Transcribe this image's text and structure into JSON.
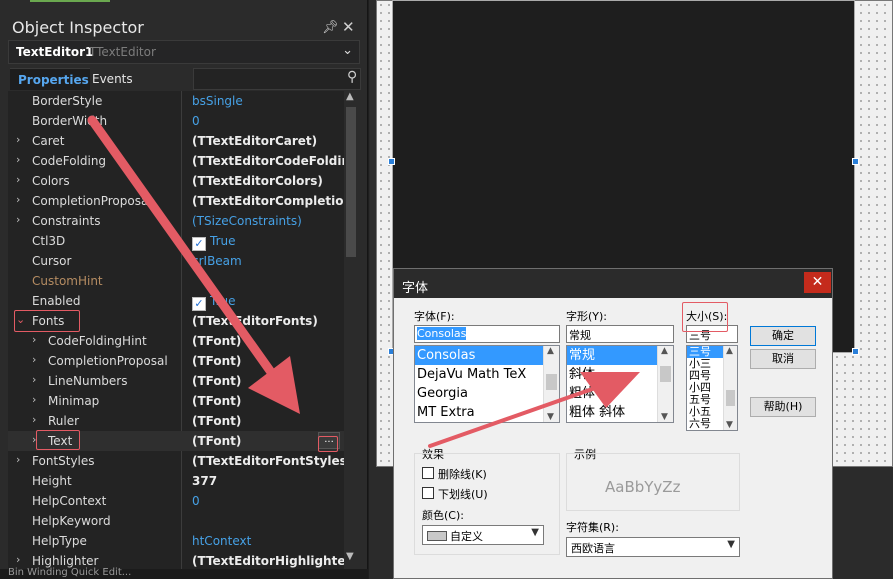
{
  "inspector": {
    "title": "Object Inspector",
    "component_name": "TextEditor1",
    "component_type": "TTextEditor",
    "tabs": [
      {
        "label": "Properties",
        "active": true
      },
      {
        "label": "Events",
        "active": false
      }
    ],
    "search_placeholder": "",
    "icons": {
      "pin": "pin-icon",
      "close": "close-icon",
      "search": "search-icon",
      "dropdown": "chevron-down-icon"
    },
    "properties": [
      {
        "name": "BorderStyle",
        "value": "bsSingle",
        "style": "blue",
        "indent": 0,
        "expander": "none"
      },
      {
        "name": "BorderWidth",
        "value": "0",
        "style": "blue",
        "indent": 0,
        "expander": "none"
      },
      {
        "name": "Caret",
        "value": "(TTextEditorCaret)",
        "style": "bold",
        "indent": 0,
        "expander": "collapsed"
      },
      {
        "name": "CodeFolding",
        "value": "(TTextEditorCodeFolding)",
        "style": "bold",
        "indent": 0,
        "expander": "collapsed"
      },
      {
        "name": "Colors",
        "value": "(TTextEditorColors)",
        "style": "bold",
        "indent": 0,
        "expander": "collapsed"
      },
      {
        "name": "CompletionProposal",
        "value": "(TTextEditorCompletionProposal)",
        "style": "bold",
        "indent": 0,
        "expander": "collapsed"
      },
      {
        "name": "Constraints",
        "value": "(TSizeConstraints)",
        "style": "blue",
        "indent": 0,
        "expander": "collapsed"
      },
      {
        "name": "Ctl3D",
        "value": "True",
        "style": "blue",
        "indent": 0,
        "expander": "none",
        "checkbox": true
      },
      {
        "name": "Cursor",
        "value": "crIBeam",
        "style": "blue",
        "indent": 0,
        "expander": "none"
      },
      {
        "name": "CustomHint",
        "value": "",
        "style": "blue",
        "indent": 0,
        "expander": "none",
        "dim": true
      },
      {
        "name": "Enabled",
        "value": "True",
        "style": "blue",
        "indent": 0,
        "expander": "none",
        "checkbox": true
      },
      {
        "name": "Fonts",
        "value": "(TTextEditorFonts)",
        "style": "bold",
        "indent": 0,
        "expander": "expanded"
      },
      {
        "name": "CodeFoldingHint",
        "value": "(TFont)",
        "style": "bold",
        "indent": 1,
        "expander": "collapsed"
      },
      {
        "name": "CompletionProposal",
        "value": "(TFont)",
        "style": "bold",
        "indent": 1,
        "expander": "collapsed"
      },
      {
        "name": "LineNumbers",
        "value": "(TFont)",
        "style": "bold",
        "indent": 1,
        "expander": "collapsed"
      },
      {
        "name": "Minimap",
        "value": "(TFont)",
        "style": "bold",
        "indent": 1,
        "expander": "collapsed"
      },
      {
        "name": "Ruler",
        "value": "(TFont)",
        "style": "bold",
        "indent": 1,
        "expander": "collapsed"
      },
      {
        "name": "Text",
        "value": "(TFont)",
        "style": "bold",
        "indent": 1,
        "expander": "collapsed",
        "selected": true,
        "ellipsis": "..."
      },
      {
        "name": "FontStyles",
        "value": "(TTextEditorFontStyles)",
        "style": "bold",
        "indent": 0,
        "expander": "collapsed"
      },
      {
        "name": "Height",
        "value": "377",
        "style": "bold",
        "indent": 0,
        "expander": "none"
      },
      {
        "name": "HelpContext",
        "value": "0",
        "style": "blue",
        "indent": 0,
        "expander": "none"
      },
      {
        "name": "HelpKeyword",
        "value": "",
        "style": "blue",
        "indent": 0,
        "expander": "none"
      },
      {
        "name": "HelpType",
        "value": "htContext",
        "style": "blue",
        "indent": 0,
        "expander": "none"
      },
      {
        "name": "Highlighter",
        "value": "(TTextEditorHighlighter)",
        "style": "bold",
        "indent": 0,
        "expander": "collapsed"
      }
    ],
    "bottom_text": "Bin Winding Quick Edit..."
  },
  "font_dialog": {
    "title": "字体",
    "close_label": "✕",
    "font_label": "字体(F):",
    "font_value": "Consolas",
    "fonts": [
      {
        "name": "Consolas",
        "selected": true
      },
      {
        "name": "DejaVu Math TeX",
        "selected": false
      },
      {
        "name": "Georgia",
        "selected": false
      },
      {
        "name": "MT Extra",
        "selected": false
      }
    ],
    "style_label": "字形(Y):",
    "style_value": "常规",
    "styles": [
      {
        "name": "常规",
        "selected": true
      },
      {
        "name": "斜体",
        "selected": false
      },
      {
        "name": "粗体",
        "selected": false
      },
      {
        "name": "粗体 斜体",
        "selected": false
      }
    ],
    "size_label": "大小(S):",
    "size_value": "三号",
    "sizes": [
      {
        "name": "三号",
        "selected": true
      },
      {
        "name": "小三",
        "selected": false
      },
      {
        "name": "四号",
        "selected": false
      },
      {
        "name": "小四",
        "selected": false
      },
      {
        "name": "五号",
        "selected": false
      },
      {
        "name": "小五",
        "selected": false
      },
      {
        "name": "六号",
        "selected": false
      }
    ],
    "ok_label": "确定",
    "cancel_label": "取消",
    "help_label": "帮助(H)",
    "effects_label": "效果",
    "strikeout_label": "删除线(K)",
    "underline_label": "下划线(U)",
    "color_label": "颜色(C):",
    "color_value": "自定义",
    "sample_label": "示例",
    "sample_text": "AaBbYyZz",
    "charset_label": "字符集(R):",
    "charset_value": "西欧语言"
  },
  "colors": {
    "accent_blue": "#46a1e6",
    "annotation_red": "#e35b64",
    "dialog_close_red": "#c42b1c",
    "selection_blue": "#3399ff"
  }
}
